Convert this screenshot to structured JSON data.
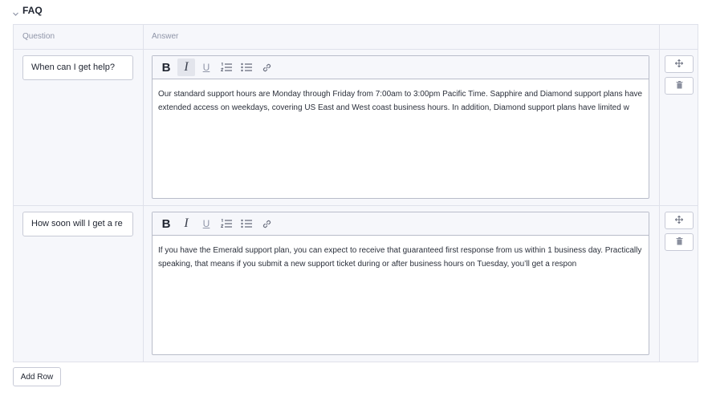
{
  "section": {
    "title": "FAQ"
  },
  "table": {
    "columns": {
      "question": "Question",
      "answer": "Answer"
    },
    "rows": [
      {
        "question": "When can I get help?",
        "answer": "Our standard support hours are Monday through Friday from 7:00am to 3:00pm Pacific Time. Sapphire and Diamond support plans have extended access on weekdays, covering US East and West coast business hours. In addition, Diamond support plans have limited w"
      },
      {
        "question": "How soon will I get a re",
        "answer": "If you have the Emerald support plan, you can expect to receive that guaranteed first response from us within 1 business day. Practically speaking, that means if you submit a new support ticket during or after business hours on Tuesday, you’ll get a respon"
      }
    ]
  },
  "toolbar": {
    "bold": "B",
    "italic": "I",
    "underline": "U"
  },
  "add_row_label": "Add Row",
  "icons": {
    "section_toggle": "chevron-down-icon",
    "toolbar": [
      "bold-icon",
      "italic-icon",
      "underline-icon",
      "ordered-list-icon",
      "bullet-list-icon",
      "link-icon"
    ],
    "row_actions": [
      "move-icon",
      "trash-icon"
    ]
  },
  "colors": {
    "border": "#dfe1ea",
    "header_bg": "#f6f7fb",
    "muted_text": "#8f95a8",
    "active_tool": "#e3e5ec"
  }
}
